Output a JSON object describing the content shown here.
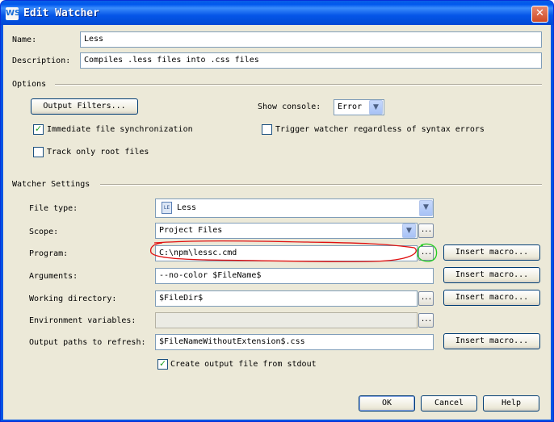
{
  "window": {
    "title": "Edit Watcher",
    "logo": "WS",
    "close": "✕"
  },
  "name": {
    "label": "Name:",
    "value": "Less"
  },
  "description": {
    "label": "Description:",
    "value": "Compiles .less files into .css files"
  },
  "options": {
    "section_title": "Options",
    "output_filters_button": "Output Filters...",
    "show_console_label": "Show console:",
    "show_console_value": "Error",
    "immediate_sync": {
      "label": "Immediate file synchronization",
      "checked": true
    },
    "trigger_regardless": {
      "label": "Trigger watcher regardless of syntax errors",
      "checked": false
    },
    "track_root": {
      "label": "Track only root files",
      "checked": false
    }
  },
  "watcher_settings": {
    "section_title": "Watcher Settings",
    "file_type": {
      "label": "File type:",
      "value": "Less",
      "icon": "less-file-icon"
    },
    "scope": {
      "label": "Scope:",
      "value": "Project Files"
    },
    "program": {
      "label": "Program:",
      "value": "C:\\npm\\lessc.cmd"
    },
    "arguments": {
      "label": "Arguments:",
      "value": "--no-color $FileName$"
    },
    "working_directory": {
      "label": "Working directory:",
      "value": "$FileDir$"
    },
    "environment_variables": {
      "label": "Environment variables:",
      "value": ""
    },
    "output_paths": {
      "label": "Output paths to refresh:",
      "value": "$FileNameWithoutExtension$.css"
    },
    "create_output": {
      "label": "Create output file from stdout",
      "checked": true
    },
    "insert_macro": "Insert macro...",
    "browse": "..."
  },
  "buttons": {
    "ok": "OK",
    "cancel": "Cancel",
    "help": "Help"
  },
  "colors": {
    "annotation_red": "#e01010",
    "annotation_green": "#22cc22",
    "accent": "#0054e3"
  }
}
